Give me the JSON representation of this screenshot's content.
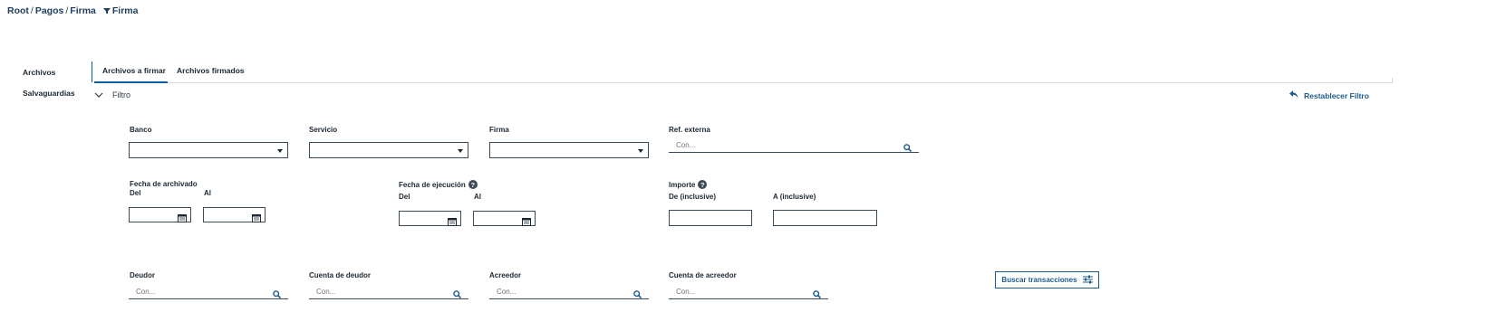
{
  "breadcrumb": {
    "items": [
      "Root",
      "Pagos",
      "Firma"
    ],
    "separator": "/",
    "current": "Firma"
  },
  "sidebar": {
    "items": [
      {
        "label": "Archivos"
      },
      {
        "label": "Salvaguardias"
      }
    ]
  },
  "tabs": [
    {
      "label": "Archivos a firmar",
      "active": true
    },
    {
      "label": "Archivos firmados",
      "active": false
    }
  ],
  "filter": {
    "toggle_label": "Filtro",
    "reset_label": "Restablecer Filtro",
    "banco": {
      "label": "Banco",
      "value": ""
    },
    "servicio": {
      "label": "Servicio",
      "value": ""
    },
    "firma": {
      "label": "Firma",
      "value": ""
    },
    "ref_externa": {
      "label": "Ref. externa",
      "placeholder": "Con..."
    },
    "fecha_archivado": {
      "label": "Fecha de archivado",
      "del_label": "Del",
      "al_label": "Al"
    },
    "fecha_ejecucion": {
      "label": "Fecha de ejecución",
      "del_label": "Del",
      "al_label": "Al"
    },
    "importe": {
      "label": "Importe",
      "de_label": "De (inclusive)",
      "a_label": "A (inclusive)"
    },
    "deudor": {
      "label": "Deudor",
      "placeholder": "Con..."
    },
    "cuenta_deudor": {
      "label": "Cuenta de deudor",
      "placeholder": "Con..."
    },
    "acreedor": {
      "label": "Acreedor",
      "placeholder": "Con..."
    },
    "cuenta_acreedor": {
      "label": "Cuenta de acreedor",
      "placeholder": "Con..."
    },
    "search_button_label": "Buscar transacciones"
  },
  "colors": {
    "accent": "#0b5ea8",
    "link": "#1d5a8c",
    "text": "#1b2733",
    "border": "#3b4a58"
  }
}
